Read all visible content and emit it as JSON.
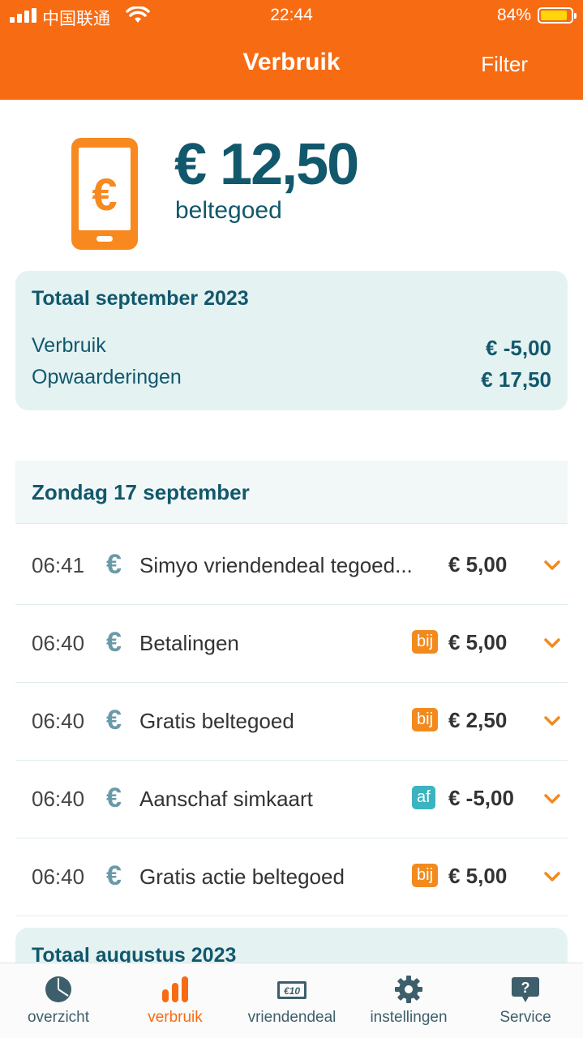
{
  "status_bar": {
    "carrier": "中国联通",
    "time": "22:44",
    "battery": "84%"
  },
  "header": {
    "title": "Verbruik",
    "filter_label": "Filter"
  },
  "balance": {
    "amount": "€ 12,50",
    "label": "beltegoed"
  },
  "month_total": {
    "title": "Totaal september 2023",
    "rows": [
      {
        "label": "Verbruik",
        "value": "€ -5,00"
      },
      {
        "label": "Opwaarderingen",
        "value": "€ 17,50"
      }
    ]
  },
  "day": {
    "title": "Zondag 17 september",
    "transactions": [
      {
        "time": "06:41",
        "icon": "€",
        "description": "Simyo vriendendeal tegoed...",
        "badge": "",
        "amount": "€ 5,00"
      },
      {
        "time": "06:40",
        "icon": "€",
        "description": "Betalingen",
        "badge": "bij",
        "amount": "€ 5,00"
      },
      {
        "time": "06:40",
        "icon": "€",
        "description": "Gratis beltegoed",
        "badge": "bij",
        "amount": "€ 2,50"
      },
      {
        "time": "06:40",
        "icon": "€",
        "description": "Aanschaf simkaart",
        "badge": "af",
        "amount": "€ -5,00"
      },
      {
        "time": "06:40",
        "icon": "€",
        "description": "Gratis actie beltegoed",
        "badge": "bij",
        "amount": "€ 5,00"
      }
    ]
  },
  "next_month": {
    "title": "Totaal augustus 2023"
  },
  "tabs": [
    {
      "label": "overzicht",
      "icon": "pie-chart-icon",
      "active": false
    },
    {
      "label": "verbruik",
      "icon": "bar-chart-icon",
      "active": true
    },
    {
      "label": "vriendendeal",
      "icon": "voucher-icon",
      "active": false,
      "icon_text": "€10"
    },
    {
      "label": "instellingen",
      "icon": "gear-icon",
      "active": false
    },
    {
      "label": "Service",
      "icon": "help-bubble-icon",
      "active": false,
      "icon_text": "?"
    }
  ],
  "colors": {
    "brand_orange": "#f76b13",
    "teal_dark": "#12586c",
    "card_bg": "#e4f2f2",
    "badge_bij": "#f28a1e",
    "badge_af": "#3bb4bf"
  }
}
